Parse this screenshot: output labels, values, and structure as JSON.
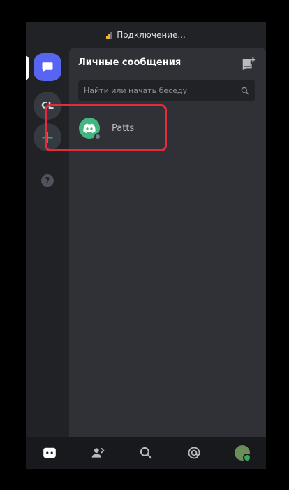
{
  "status_bar": {
    "text": "Подключение..."
  },
  "guilds": [
    {
      "label": "CL"
    },
    {
      "label": "+"
    },
    {
      "label": "?"
    }
  ],
  "dm_panel": {
    "title": "Личные сообщения",
    "search_placeholder": "Найти или начать беседу"
  },
  "dm_list": [
    {
      "name": "Patts",
      "status": "offline"
    }
  ],
  "colors": {
    "blurple": "#5865f2",
    "green": "#43b581",
    "highlight": "#e22b3c"
  }
}
